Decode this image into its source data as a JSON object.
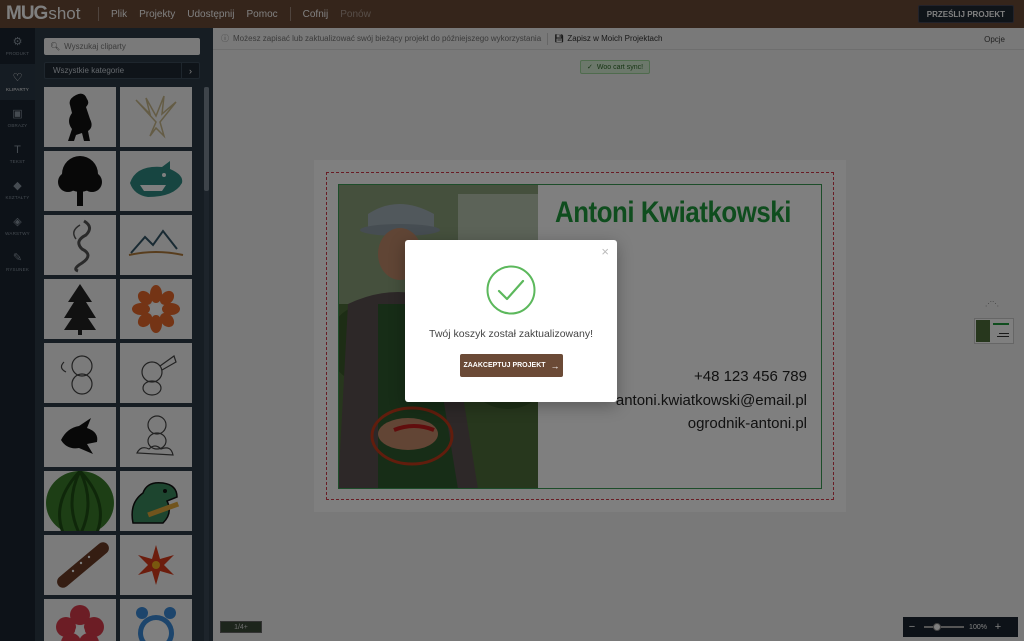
{
  "app": {
    "logo_mug": "MUG",
    "logo_shot": "shot",
    "menu": [
      "Plik",
      "Projekty",
      "Udostępnij",
      "Pomoc"
    ],
    "undo": "Cofnij",
    "redo": "Ponów",
    "send_button": "PRZEŚLIJ PROJEKT"
  },
  "rail": {
    "items": [
      {
        "label": "PRODUKT",
        "icon": "product-icon"
      },
      {
        "label": "KLIPARTY",
        "icon": "heart-icon"
      },
      {
        "label": "OBRAZY",
        "icon": "image-icon"
      },
      {
        "label": "TEKST",
        "icon": "text-icon"
      },
      {
        "label": "KSZTAŁTY",
        "icon": "diamond-icon"
      },
      {
        "label": "WARSTWY",
        "icon": "layers-icon"
      },
      {
        "label": "RYSUNEK",
        "icon": "pencil-icon"
      }
    ]
  },
  "clipart": {
    "search_placeholder": "Wyszukaj cliparty",
    "category": "Wszystkie kategorie",
    "items": [
      "lion-clipart",
      "eagle-clipart",
      "tree-clipart",
      "shark-clipart",
      "dragon-clipart",
      "mountains-clipart",
      "pine-tree-clipart",
      "flower-clipart",
      "cupid-clipart",
      "cupid-horn-clipart",
      "dragon-head-clipart",
      "cupid-cloud-clipart",
      "watermelon-clipart",
      "dinosaur-clipart",
      "sausage-clipart",
      "red-flower-clipart",
      "sakura-clipart",
      "alarm-clock-clipart"
    ]
  },
  "toolbar": {
    "info_text": "Możesz zapisać lub zaktualizować swój bieżący projekt do późniejszego wykorzystania",
    "save_link": "Zapisz w Moich Projektach",
    "options": "Opcje",
    "sync_badge": "Woo cart sync!"
  },
  "card": {
    "name": "Antoni Kwiatkowski",
    "phone": "+48 123 456 789",
    "email": "antoni.kwiatkowski@email.pl",
    "website": "ogrodnik-antoni.pl"
  },
  "zoom": {
    "minus": "−",
    "plus": "+",
    "value": "100%",
    "minimap_label": "1/4+"
  },
  "modal": {
    "message": "Twój koszyk został zaktualizowany!",
    "accept_button": "ZAAKCEPTUJ PROJEKT",
    "close": "×"
  },
  "colors": {
    "brand_brown": "#6b4a36",
    "dark_panel": "#2c3a47",
    "name_green": "#1e9a3c",
    "success_green": "#5cb85c"
  }
}
